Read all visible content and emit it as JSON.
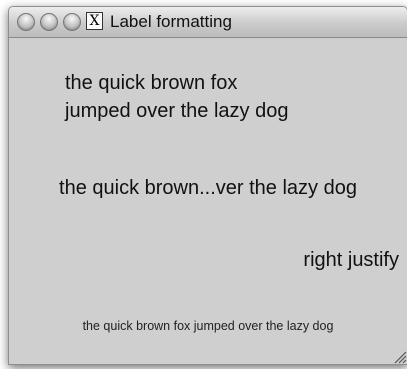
{
  "window": {
    "title": "Label formatting",
    "title_icon_glyph": "X"
  },
  "labels": {
    "wrapped_line1": "the quick brown fox",
    "wrapped_line2": "jumped over the lazy dog",
    "truncated": "the quick brown...ver the lazy dog",
    "right_justified": "right justify",
    "small": "the quick brown fox jumped over the lazy dog"
  },
  "icons": {
    "close": "close-icon",
    "minimize": "minimize-icon",
    "zoom": "zoom-icon",
    "app": "x11-icon",
    "resize": "resize-grip-icon"
  }
}
